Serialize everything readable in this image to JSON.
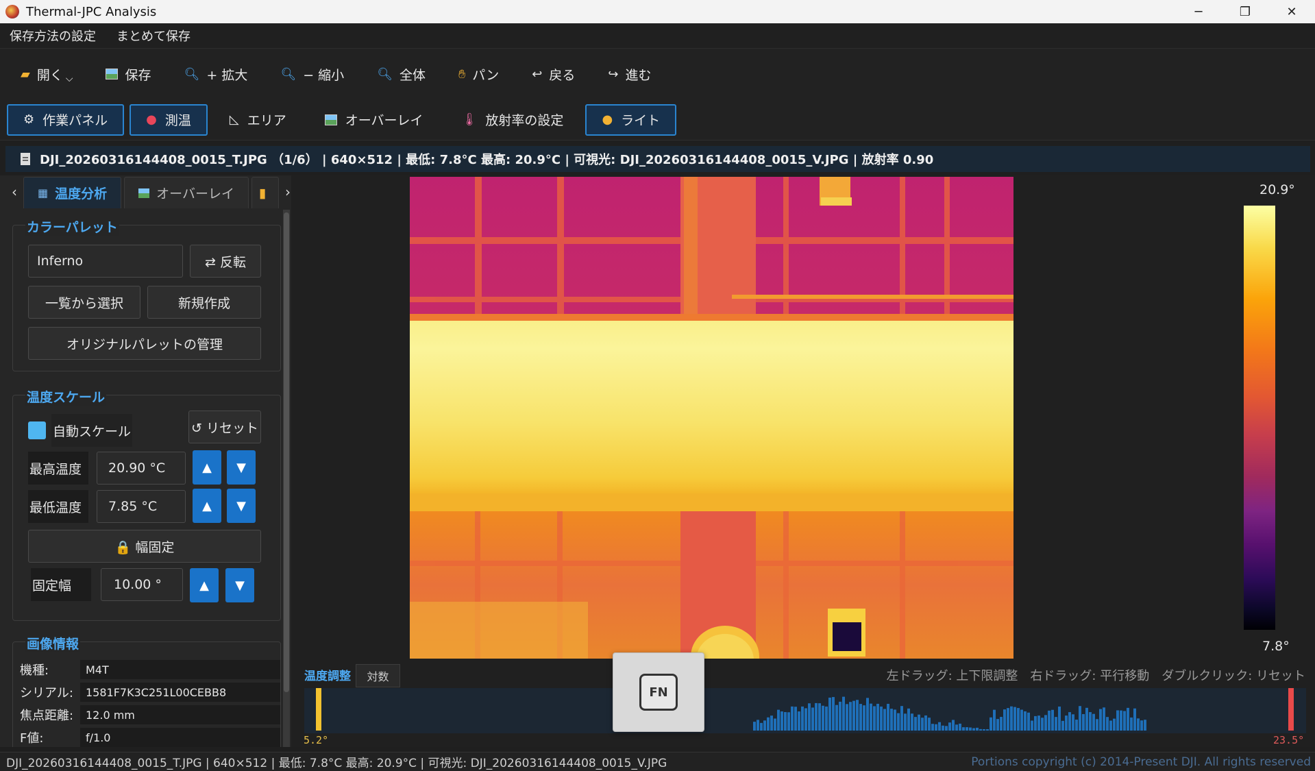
{
  "window": {
    "title": "Thermal-JPC Analysis",
    "minimize": "─",
    "maximize": "❐",
    "close": "✕"
  },
  "menu": [
    "保存方法の設定",
    "まとめて保存"
  ],
  "toolbar": {
    "open": "開く",
    "save": "保存",
    "zoom_in": "+ 拡大",
    "zoom_out": "− 縮小",
    "fit": "全体",
    "pan": "パン",
    "back": "戻る",
    "forward": "進む"
  },
  "modes": {
    "panel": "作業パネル",
    "measure": "測温",
    "area": "エリア",
    "overlay": "オーバーレイ",
    "emissivity": "放射率の設定",
    "light": "ライト"
  },
  "info_strip": "DJI_20260316144408_0015_T.JPG （1/6） | 640×512 | 最低: 7.8°C 最高: 20.9°C | 可視光: DJI_20260316144408_0015_V.JPG | 放射率 0.90",
  "tabs": {
    "temp_analysis": "温度分析",
    "overlay": "オーバーレイ"
  },
  "palette": {
    "title": "カラーパレット",
    "current": "Inferno",
    "reverse": "⇄ 反転",
    "select": "一覧から選択",
    "new": "新規作成",
    "manage": "オリジナルパレットの管理"
  },
  "scale": {
    "title": "温度スケール",
    "auto_label": "自動スケール",
    "reset": "↺ リセット",
    "max_label": "最高温度",
    "max_value": "20.90 °C",
    "min_label": "最低温度",
    "min_value": "7.85 °C",
    "lock": "🔒 幅固定",
    "width_label": "固定幅",
    "width_value": "10.00 °",
    "up": "▲",
    "down": "▼"
  },
  "image_info": {
    "title": "画像情報",
    "rows": [
      {
        "key": "機種:",
        "value": "M4T"
      },
      {
        "key": "シリアル:",
        "value": "1581F7K3C251L00CEBB8"
      },
      {
        "key": "焦点距離:",
        "value": "12.0 mm"
      },
      {
        "key": "F値:",
        "value": "f/1.0"
      }
    ]
  },
  "colorbar": {
    "max": "20.9°",
    "min": "7.8°"
  },
  "histogram": {
    "title": "温度調整",
    "log_button": "対数",
    "hint": "左ドラッグ: 上下限調整　右ドラッグ: 平行移動　ダブルクリック: リセット",
    "low": "5.2°",
    "high": "23.5°",
    "bar_color": "#1f6fb8",
    "low_marker_color": "#f2c230",
    "high_marker_color": "#e84a4a"
  },
  "fn_key": "FN",
  "status": {
    "text": "DJI_20260316144408_0015_T.JPG  |  640×512  |  最低: 7.8°C  最高: 20.9°C  |  可視光: DJI_20260316144408_0015_V.JPG",
    "copyright": "Portions copyright (c) 2014-Present DJI. All rights reserved"
  },
  "colors": {
    "accent": "#4da8f0",
    "active_border": "#2a85d0",
    "spin_button": "#1a73c9"
  }
}
